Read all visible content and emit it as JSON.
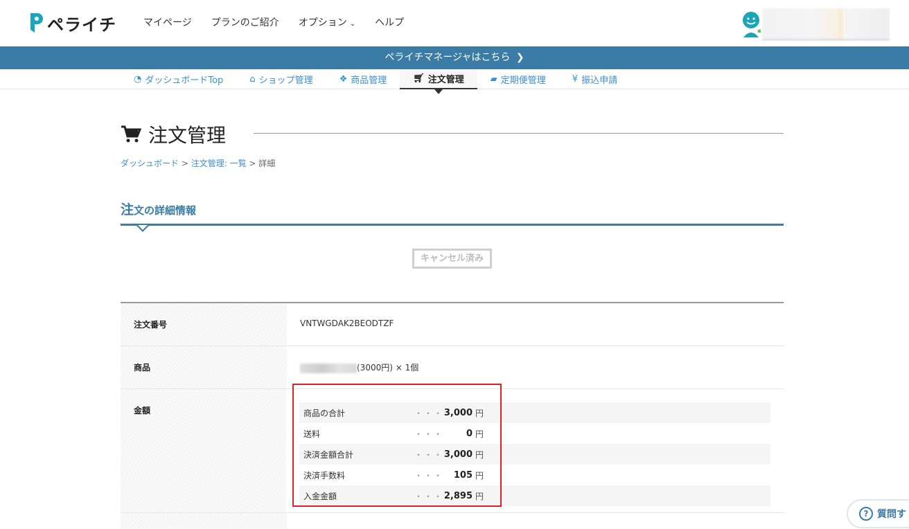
{
  "header": {
    "logo_text": "ペライチ",
    "nav": [
      {
        "label": "マイページ"
      },
      {
        "label": "プランのご紹介"
      },
      {
        "label": "オプション"
      },
      {
        "label": "ヘルプ"
      }
    ]
  },
  "manager_bar": {
    "label": "ペライチマネージャはこちら"
  },
  "subnav": [
    {
      "label": "ダッシュボードTop",
      "icon": "dashboard-icon"
    },
    {
      "label": "ショップ管理",
      "icon": "home-icon"
    },
    {
      "label": "商品管理",
      "icon": "cubes-icon"
    },
    {
      "label": "注文管理",
      "icon": "cart-icon",
      "active": true
    },
    {
      "label": "定期便管理",
      "icon": "truck-icon"
    },
    {
      "label": "振込申請",
      "icon": "yen-icon"
    }
  ],
  "page": {
    "title": "注文管理",
    "breadcrumb": [
      "ダッシュボード",
      "注文管理: 一覧",
      "詳細"
    ],
    "section_title_first": "注",
    "section_title_rest": "文の詳細情報",
    "status_badge": "キャンセル済み"
  },
  "details": {
    "order_number_label": "注文番号",
    "order_number": "VNTWGDAK2BEODTZF",
    "product_label": "商品",
    "product_value": "(3000円) × 1個",
    "amount_label": "金額",
    "amounts": [
      {
        "label": "商品の合計",
        "dots": "・・・",
        "value": "3,000",
        "unit": "円"
      },
      {
        "label": "送料",
        "dots": "・・・",
        "value": "0",
        "unit": "円"
      },
      {
        "label": "決済金額合計",
        "dots": "・・・",
        "value": "3,000",
        "unit": "円"
      },
      {
        "label": "決済手数料",
        "dots": "・・・",
        "value": "105",
        "unit": "円"
      },
      {
        "label": "入金金額",
        "dots": "・・・",
        "value": "2,895",
        "unit": "円"
      }
    ]
  },
  "help_button": {
    "label": "質問す"
  },
  "colors": {
    "brand_blue": "#3a7ca5",
    "link_blue": "#3b8fd1",
    "highlight_red": "#e02020",
    "logo_teal": "#1aa6b7"
  }
}
